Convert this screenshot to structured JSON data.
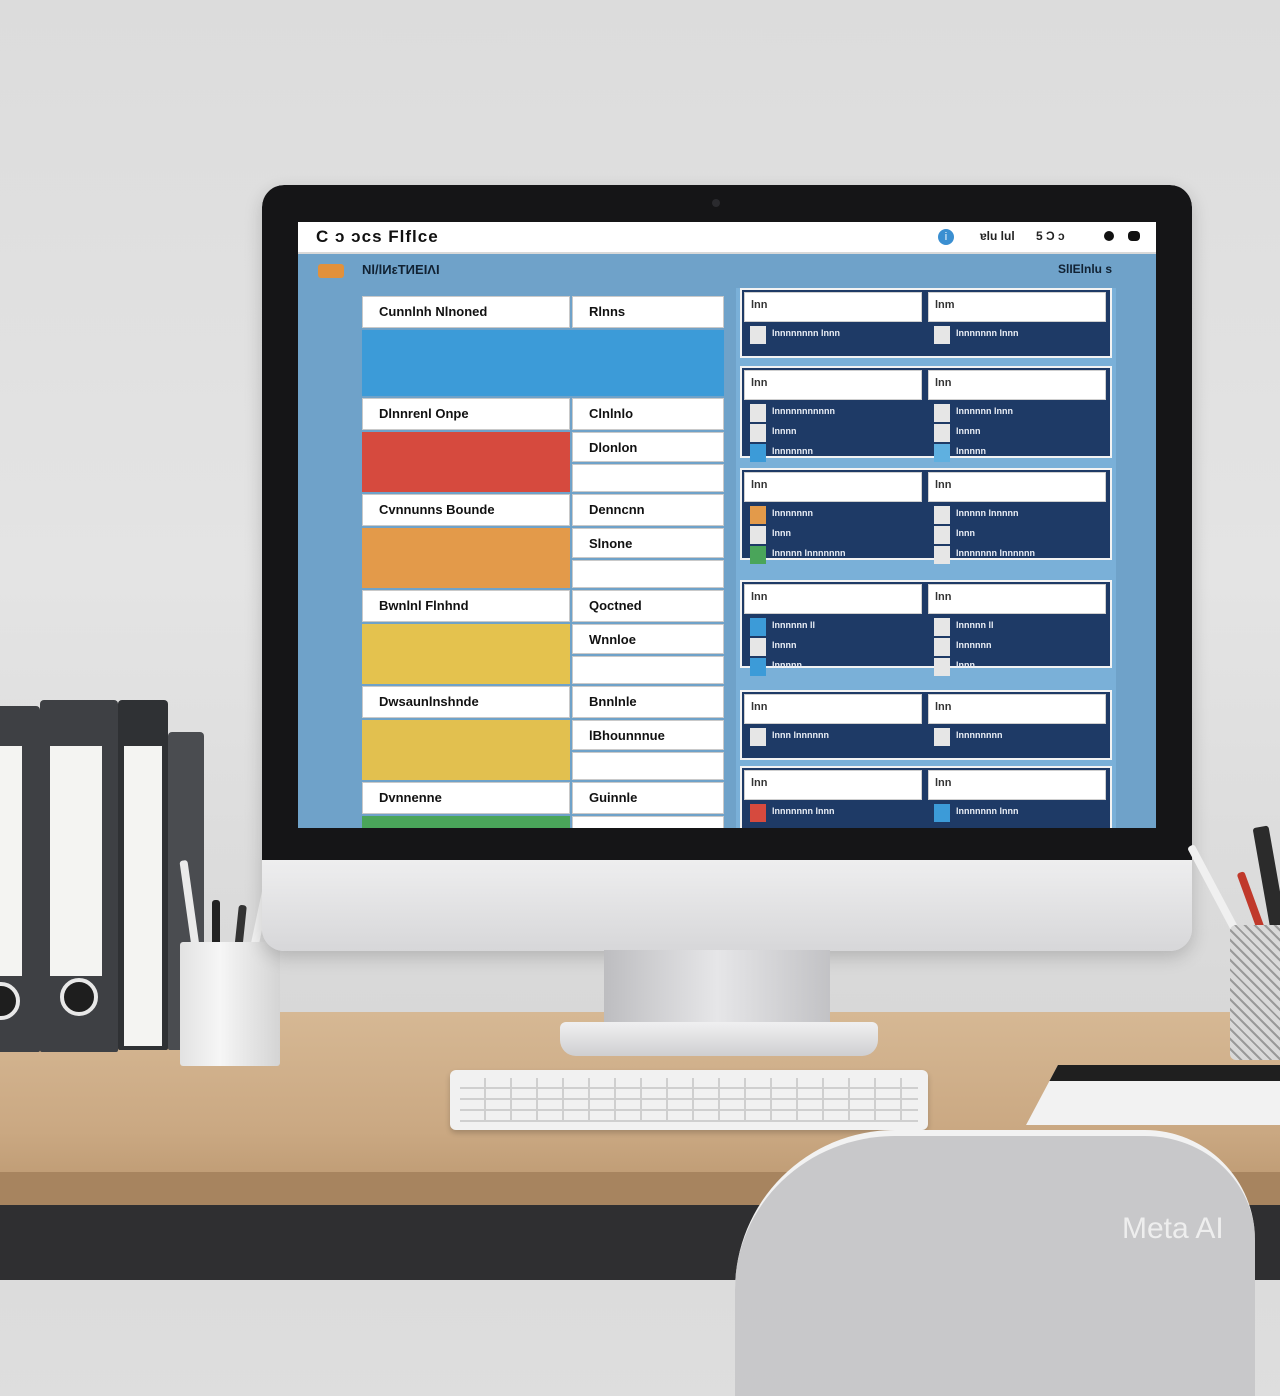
{
  "app": {
    "title": "C ɔ ɔcs  Flflce",
    "subtitle": "Nl/lИεΤИΕΙΛΙ",
    "right_label": "SlΙΕlnlu s",
    "toolbar_text_1": "ɐlu lul",
    "toolbar_text_2": "5 Ͻ ɔ",
    "info_glyph": "i"
  },
  "left_table": {
    "rows": [
      {
        "header_left": "Cunnlnh Nlnoned",
        "header_right": "Rlnns",
        "band_color": "#3c9bd8",
        "sub_right": [],
        "band_full": true
      },
      {
        "header_left": "Dlnnrenl Onpe",
        "header_right": "Clnlnlo",
        "band_color": "#d64a3e",
        "sub_right": [
          "Dlonlon"
        ]
      },
      {
        "header_left": "Cvnnunns Bounde",
        "header_right": "Denncnn",
        "band_color": "#e39a4a",
        "sub_right": [
          "Slnone"
        ]
      },
      {
        "header_left": "Bwnlnl Flnhnd",
        "header_right": "Qoctned",
        "band_color": "#e4c24e",
        "sub_right": [
          "Wnnloe"
        ]
      },
      {
        "header_left": "Dwsaunlnshnde",
        "header_right": "Bnnlnle",
        "band_color": "#e2c04f",
        "sub_right": [
          "lBhounnnue"
        ]
      },
      {
        "header_left": "Dvnnenne",
        "header_right": "Guinnle",
        "band_color": "#4aa55a",
        "sub_right": []
      }
    ]
  },
  "right_panels": [
    {
      "cards": [
        {
          "head": "lnn",
          "lines": [
            {
              "chip": "#e6e6e6",
              "text": "lnnnnnnnn lnnn"
            }
          ]
        },
        {
          "head": "lnm",
          "lines": [
            {
              "chip": "#e6e6e6",
              "text": "lnnnnnnn lnnn"
            }
          ]
        }
      ]
    },
    {
      "cards": [
        {
          "head": "lnn",
          "lines": [
            {
              "chip": "#e6e6e6",
              "text": "lnnnnnnnnnnn"
            },
            {
              "chip": "#e6e6e6",
              "text": "lnnnn"
            },
            {
              "chip": "#3c9bd8",
              "text": "lnnnnnnn"
            }
          ]
        },
        {
          "head": "lnn",
          "lines": [
            {
              "chip": "#e6e6e6",
              "text": "lnnnnnn lnnn"
            },
            {
              "chip": "#e6e6e6",
              "text": "lnnnn"
            },
            {
              "chip": "#5fb0e0",
              "text": "lnnnnn"
            }
          ]
        }
      ]
    },
    {
      "cards": [
        {
          "head": "lnn",
          "lines": [
            {
              "chip": "#e39a4a",
              "text": "lnnnnnnn"
            },
            {
              "chip": "#e6e6e6",
              "text": "lnnn"
            },
            {
              "chip": "#4aa55a",
              "text": "lnnnnn lnnnnnnn"
            }
          ]
        },
        {
          "head": "lnn",
          "lines": [
            {
              "chip": "#e6e6e6",
              "text": "lnnnnn lnnnnn"
            },
            {
              "chip": "#e6e6e6",
              "text": "lnnn"
            },
            {
              "chip": "#e6e6e6",
              "text": "lnnnnnnn lnnnnnn"
            }
          ]
        }
      ]
    },
    {
      "cards": [
        {
          "head": "lnn",
          "lines": [
            {
              "chip": "#3c9bd8",
              "text": "lnnnnnn ll"
            },
            {
              "chip": "#e6e6e6",
              "text": "lnnnn"
            },
            {
              "chip": "#3c9bd8",
              "text": "lnnnnn"
            }
          ]
        },
        {
          "head": "lnn",
          "lines": [
            {
              "chip": "#e6e6e6",
              "text": "lnnnnn ll"
            },
            {
              "chip": "#e6e6e6",
              "text": "lnnnnnn"
            },
            {
              "chip": "#e6e6e6",
              "text": "lnnn"
            }
          ]
        }
      ]
    },
    {
      "cards": [
        {
          "head": "lnn",
          "lines": [
            {
              "chip": "#e6e6e6",
              "text": "lnnn lnnnnnn"
            }
          ]
        },
        {
          "head": "lnn",
          "lines": [
            {
              "chip": "#e6e6e6",
              "text": "lnnnnnnnn"
            }
          ]
        }
      ]
    },
    {
      "cards": [
        {
          "head": "lnn",
          "lines": [
            {
              "chip": "#d64a3e",
              "text": "lnnnnnnn lnnn"
            }
          ]
        },
        {
          "head": "lnn",
          "lines": [
            {
              "chip": "#3c9bd8",
              "text": "lnnnnnnn lnnn"
            }
          ]
        }
      ]
    }
  ],
  "watermark": "Meta AI",
  "colors": {
    "screen_bg": "#6fa2c9",
    "panel_bg": "#1e3a66",
    "accent_orange": "#e2913b"
  }
}
